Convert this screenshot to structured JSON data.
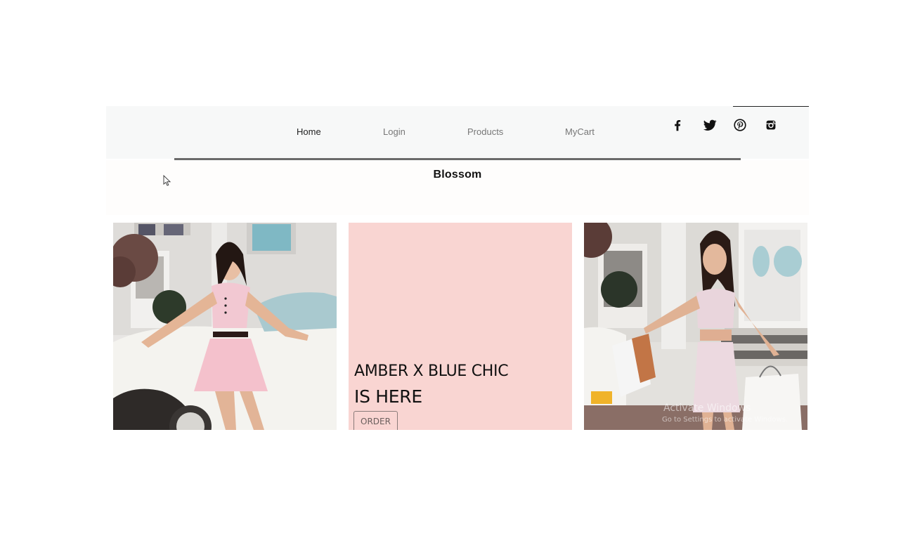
{
  "nav": {
    "items": [
      {
        "label": "Home",
        "active": true
      },
      {
        "label": "Login",
        "active": false
      },
      {
        "label": "Products",
        "active": false
      },
      {
        "label": "MyCart",
        "active": false
      }
    ],
    "social_icons": [
      "facebook-icon",
      "twitter-icon",
      "pinterest-icon",
      "instagram-icon"
    ]
  },
  "brand": {
    "name": "Blossom"
  },
  "promo": {
    "line1": "AMBER X BLUE CHIC",
    "line2": "IS HERE",
    "button_label": "ORDER"
  },
  "watermark": {
    "title": "Activate Windows",
    "subtitle": "Go to Settings to activate Windows."
  },
  "colors": {
    "navbar_bg": "#f7f8f8",
    "promo_bg": "#f9d5d2",
    "divider": "#6b6b6b"
  }
}
